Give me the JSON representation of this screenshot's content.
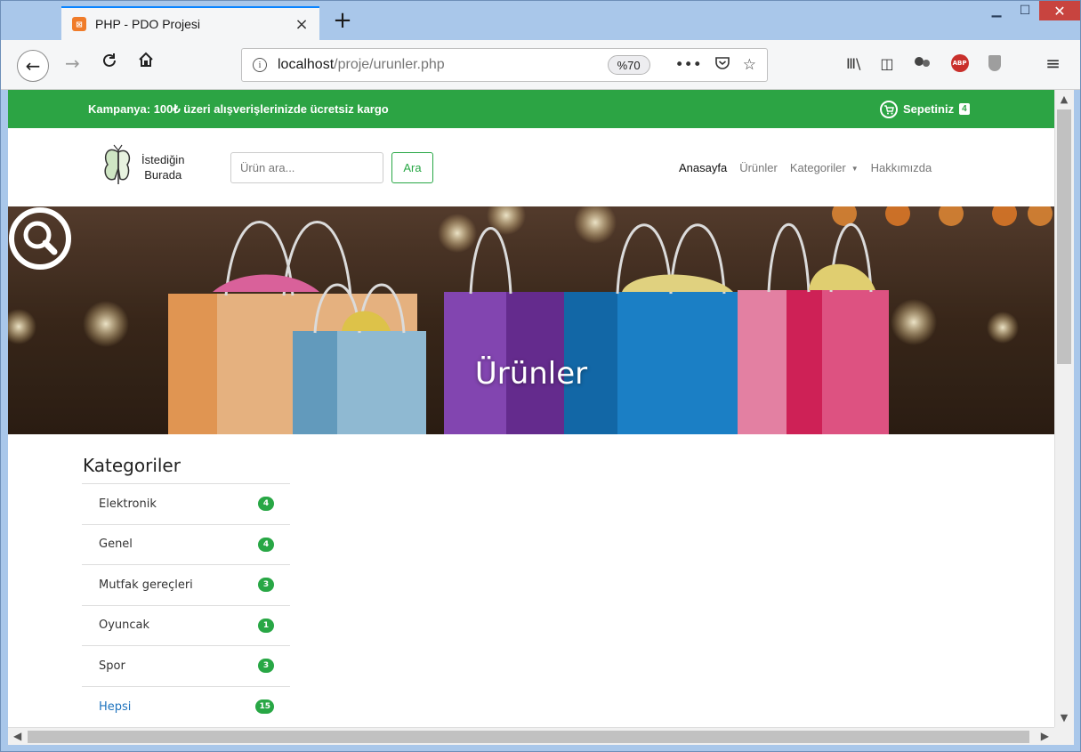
{
  "browser": {
    "tab_title": "PHP - PDO Projesi",
    "tab_icon_glyph": "☒",
    "new_tab_glyph": "+",
    "close_tab_glyph": "×",
    "url_host": "localhost",
    "url_path": "/proje/urunler.php",
    "zoom": "%70",
    "window_minimize": "▁",
    "window_maximize": "☐",
    "window_close": "✕",
    "icons": {
      "back": "←",
      "forward": "→",
      "reload": "C",
      "home": "⌂",
      "info": "i",
      "page_actions": "•••",
      "pocket": "♡",
      "bookmark": "☆",
      "library": "Ⅲ\\",
      "sidebar": "◫",
      "extensions": "●",
      "abp": "ABP",
      "menu": "≡"
    }
  },
  "campaign": {
    "text": "Kampanya: 100₺ üzeri alışverişlerinizde ücretsiz kargo",
    "cart_label": "Sepetiniz",
    "cart_count": "4"
  },
  "header": {
    "logo_line1": "İstediğin",
    "logo_line2": "Burada",
    "search_placeholder": "Ürün ara...",
    "search_button": "Ara",
    "menu": [
      "Anasayfa",
      "Ürünler",
      "Kategoriler",
      "Hakkımızda"
    ]
  },
  "hero": {
    "title": "Ürünler"
  },
  "sidebar": {
    "title": "Kategoriler",
    "items": [
      {
        "label": "Elektronik",
        "count": "4"
      },
      {
        "label": "Genel",
        "count": "4"
      },
      {
        "label": "Mutfak gereçleri",
        "count": "3"
      },
      {
        "label": "Oyuncak",
        "count": "1"
      },
      {
        "label": "Spor",
        "count": "3"
      },
      {
        "label": "Hepsi",
        "count": "15"
      }
    ]
  },
  "colors": {
    "brand_green": "#2ca444",
    "link_blue": "#1e73be",
    "firefox_blue": "#0a84ff"
  }
}
